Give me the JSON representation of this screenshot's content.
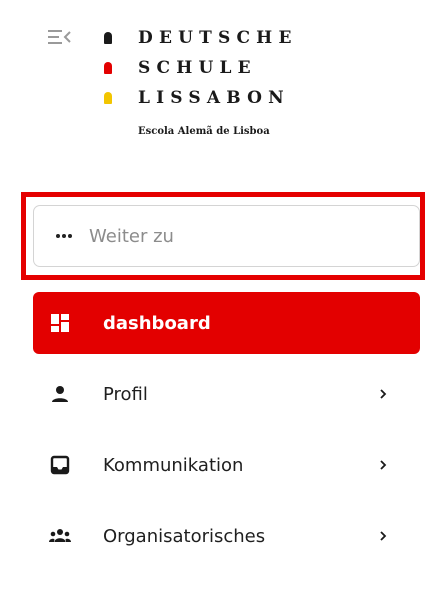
{
  "header": {
    "collapse_icon": "menu-collapse-icon",
    "logo": {
      "line1": "DEUTSCHE",
      "line2": "SCHULE",
      "line3": "LISSABON",
      "subtitle": "Escola Alemã de Lisboa",
      "colors": [
        "#1a1a1a",
        "#e30000",
        "#f2c500"
      ]
    }
  },
  "search": {
    "placeholder": "Weiter zu",
    "value": "",
    "icon": "more-horizontal-icon"
  },
  "nav": {
    "items": [
      {
        "label": "dashboard",
        "icon": "dashboard-icon",
        "active": true
      },
      {
        "label": "Profil",
        "icon": "person-icon",
        "active": false
      },
      {
        "label": "Kommunikation",
        "icon": "inbox-icon",
        "active": false
      },
      {
        "label": "Organisatorisches",
        "icon": "group-icon",
        "active": false
      }
    ]
  },
  "colors": {
    "accent": "#e30000",
    "highlight_frame": "#e50000",
    "text": "#1f1f1f"
  }
}
